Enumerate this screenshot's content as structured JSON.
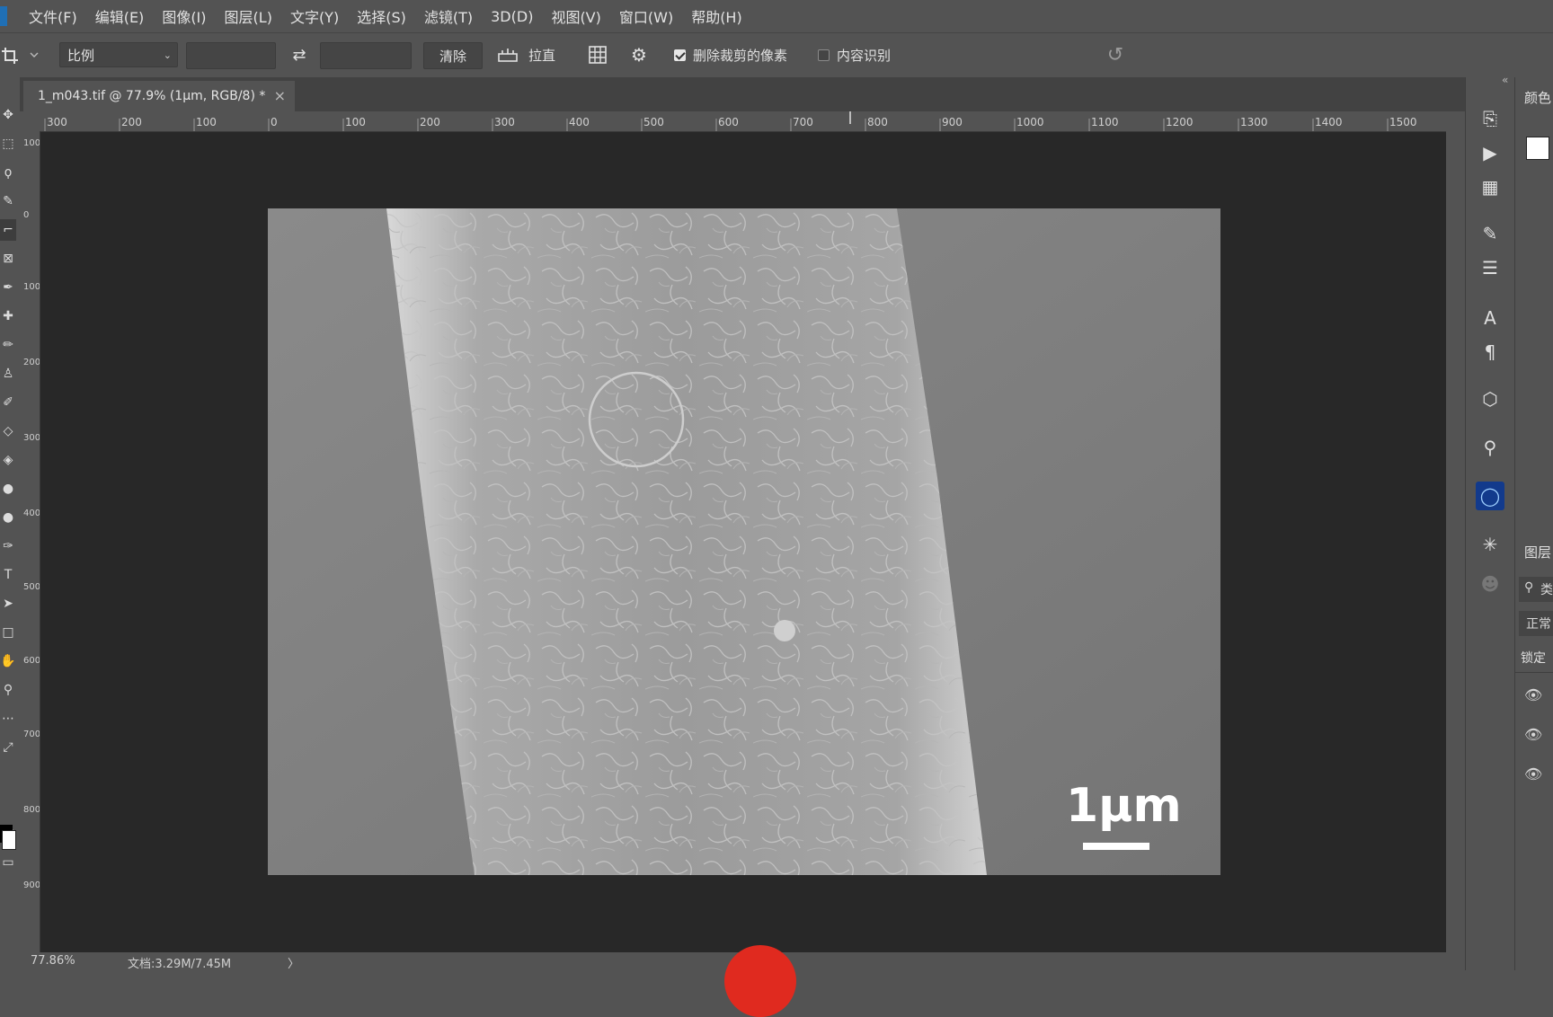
{
  "menu": [
    "文件(F)",
    "编辑(E)",
    "图像(I)",
    "图层(L)",
    "文字(Y)",
    "选择(S)",
    "滤镜(T)",
    "3D(D)",
    "视图(V)",
    "窗口(W)",
    "帮助(H)"
  ],
  "options": {
    "ratio_select": "比例",
    "clear_label": "清除",
    "straighten_label": "拉直",
    "delete_cropped_label": "删除裁剪的像素",
    "delete_cropped_checked": true,
    "content_aware_label": "内容识别",
    "content_aware_checked": false
  },
  "document_tab": {
    "title": "1_m043.tif @ 77.9% (1μm, RGB/8) *",
    "close": "×"
  },
  "ruler_top_labels": [
    "300",
    "200",
    "100",
    "0",
    "100",
    "200",
    "300",
    "400",
    "500",
    "600",
    "700",
    "800",
    "900",
    "1000",
    "1100",
    "1200",
    "1300",
    "1400",
    "1500"
  ],
  "ruler_left_labels": [
    "100",
    "0",
    "100",
    "200",
    "300",
    "400",
    "500",
    "600",
    "700",
    "800",
    "900"
  ],
  "image": {
    "scale_bar_label": "1μm"
  },
  "status": {
    "zoom": "77.86%",
    "doc_size": "文档:3.29M/7.45M",
    "arrow": "〉"
  },
  "right_panel": {
    "color_tab": "颜色",
    "layers_tab": "图层",
    "search_fragment": "类",
    "blend_fragment": "正常",
    "lock_label": "锁定"
  },
  "colors": {
    "ui_bg": "#535353",
    "canvas_bg": "#282828",
    "accent_red": "#e02a1f"
  }
}
